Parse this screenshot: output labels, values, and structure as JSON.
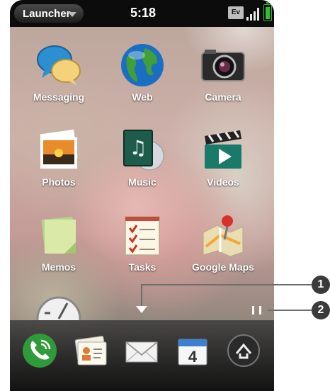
{
  "statusbar": {
    "launcher_label": "Launcher",
    "time": "5:18",
    "network_badge": "Ev",
    "battery_color": "#2fbf2f"
  },
  "apps": [
    {
      "label": "Messaging",
      "icon": "messaging-icon"
    },
    {
      "label": "Web",
      "icon": "web-globe-icon"
    },
    {
      "label": "Camera",
      "icon": "camera-icon"
    },
    {
      "label": "Photos",
      "icon": "photos-icon"
    },
    {
      "label": "Music",
      "icon": "music-icon"
    },
    {
      "label": "Videos",
      "icon": "videos-clapper-icon"
    },
    {
      "label": "Memos",
      "icon": "memos-icon"
    },
    {
      "label": "Tasks",
      "icon": "tasks-checklist-icon"
    },
    {
      "label": "Google Maps",
      "icon": "google-maps-icon"
    },
    {
      "label": "",
      "icon": "clock-icon"
    }
  ],
  "quicklaunch": [
    {
      "icon": "phone-icon"
    },
    {
      "icon": "contacts-icon"
    },
    {
      "icon": "email-icon"
    },
    {
      "icon": "calendar-icon",
      "text": "4"
    },
    {
      "icon": "launcher-up-arrow-icon"
    }
  ],
  "callouts": [
    "1",
    "2"
  ]
}
